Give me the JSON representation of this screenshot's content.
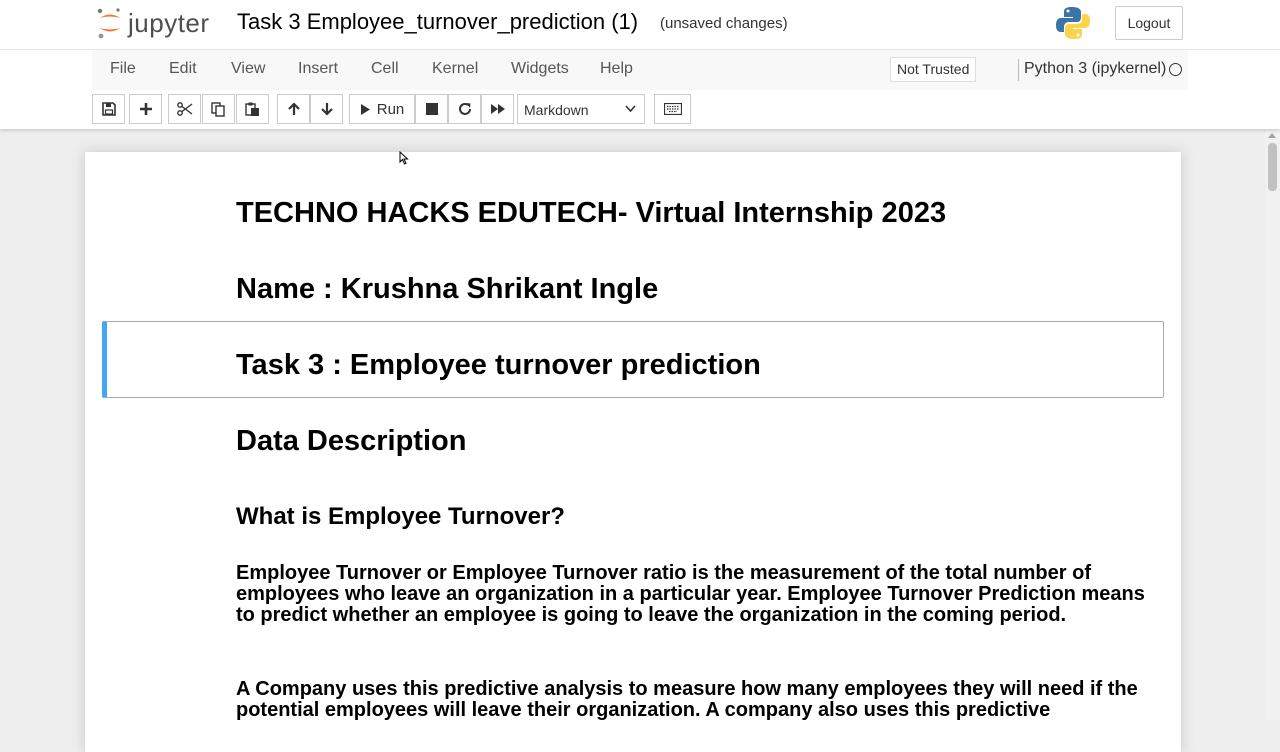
{
  "header": {
    "logo_text": "jupyter",
    "notebook_title": "Task 3 Employee_turnover_prediction (1)",
    "save_status": "(unsaved changes)",
    "logout_label": "Logout",
    "python_logo_icon": "python-logo-icon"
  },
  "menubar": {
    "items": [
      "File",
      "Edit",
      "View",
      "Insert",
      "Cell",
      "Kernel",
      "Widgets",
      "Help"
    ],
    "trust_label": "Not Trusted",
    "kernel_name": "Python 3 (ipykernel)"
  },
  "toolbar": {
    "run_label": "Run",
    "cell_type_selected": "Markdown",
    "buttons": [
      "save-icon",
      "plus-icon",
      "scissors-icon",
      "copy-icon",
      "paste-icon",
      "arrow-up-icon",
      "arrow-down-icon",
      "play-icon",
      "stop-icon",
      "restart-icon",
      "fast-forward-icon",
      "keyboard-icon"
    ]
  },
  "notebook": {
    "heading_org": "TECHNO HACKS EDUTECH- Virtual Internship 2023",
    "heading_name": "Name : Krushna Shrikant Ingle",
    "heading_task": "Task 3 : Employee turnover prediction",
    "heading_data_desc": "Data Description",
    "heading_what_is": "What is Employee Turnover?",
    "para1": "Employee Turnover or Employee Turnover ratio is the measurement of the total number of employees who leave an organization in a particular year. Employee Turnover Prediction means to predict whether an employee is going to leave the organization in the coming period.",
    "para2": "A Company uses this predictive analysis to measure how many employees they will need if the potential employees will leave their organization. A company also uses this predictive"
  },
  "colors": {
    "accent_selected_cell": "#42a5f5",
    "jupyter_orange": "#f37726"
  }
}
